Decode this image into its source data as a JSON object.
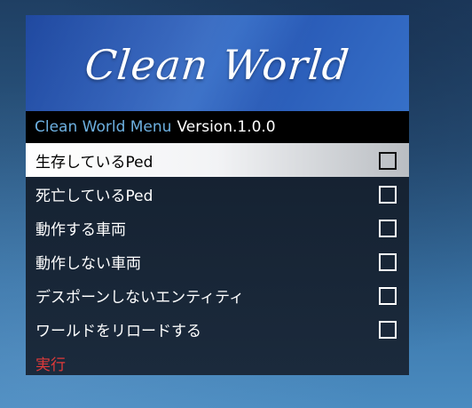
{
  "menu": {
    "banner_title": "Clean World",
    "subheader": {
      "name": "Clean World Menu",
      "version": "Version.1.0.0"
    },
    "items": [
      {
        "label": "生存しているPed",
        "checked": false,
        "selected": true
      },
      {
        "label": "死亡しているPed",
        "checked": false,
        "selected": false
      },
      {
        "label": "動作する車両",
        "checked": false,
        "selected": false
      },
      {
        "label": "動作しない車両",
        "checked": false,
        "selected": false
      },
      {
        "label": "デスポーンしないエンティティ",
        "checked": false,
        "selected": false
      },
      {
        "label": "ワールドをリロードする",
        "checked": false,
        "selected": false
      }
    ],
    "action_label": "実行"
  },
  "colors": {
    "banner": "#2a5cb8",
    "subheader_bg": "#000000",
    "subheader_name": "#6db0e0",
    "selected_bg": "#ffffff",
    "action_text": "#e03a3a"
  },
  "icons": {
    "checkbox": "checkbox-empty-icon"
  }
}
